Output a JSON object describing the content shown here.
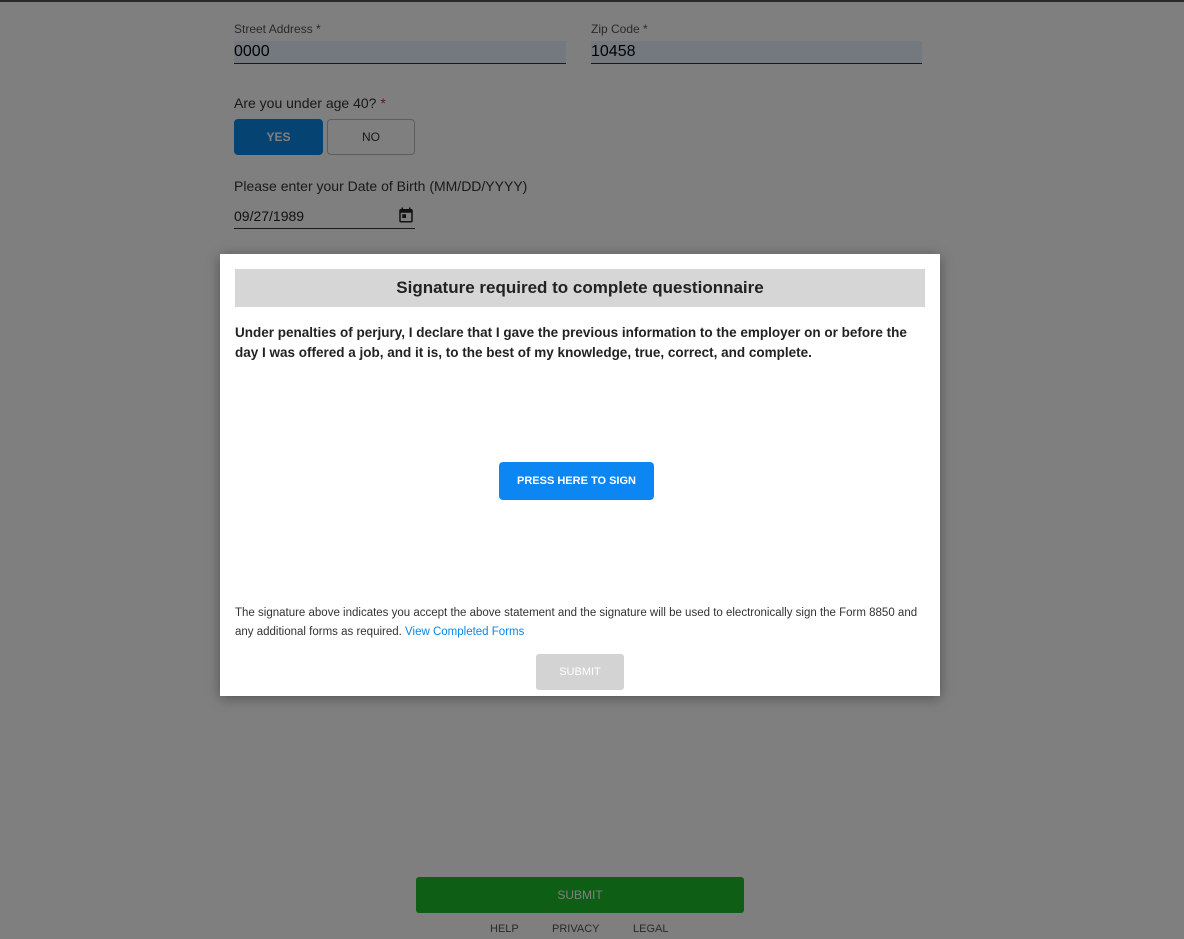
{
  "form": {
    "street_label": "Street Address *",
    "street_value": "0000",
    "zip_label": "Zip Code *",
    "zip_value": "10458",
    "age_question": "Are you under age 40?",
    "age_required_mark": "*",
    "yes_label": "YES",
    "no_label": "NO",
    "dob_question": "Please enter your Date of Birth (MM/DD/YYYY)",
    "dob_value": "09/27/1989"
  },
  "modal": {
    "title": "Signature required to complete questionnaire",
    "statement": "Under penalties of perjury, I declare that I gave the previous information to the employer on or before the day I was offered a job, and it is, to the best of my knowledge, true, correct, and complete.",
    "sign_button": "PRESS HERE TO SIGN",
    "note": "The signature above indicates you accept the above statement and the signature will be used to electronically sign the Form 8850 and any additional forms as required.",
    "view_link": "View Completed Forms",
    "submit_label": "SUBMIT"
  },
  "footer": {
    "submit_label": "SUBMIT",
    "links": [
      "HELP",
      "PRIVACY",
      "LEGAL"
    ]
  },
  "colors": {
    "primary_blue": "#0b86e6",
    "submit_green": "#1cbd2d",
    "required_red": "#d32f2f"
  },
  "icons": {
    "date": "calendar-icon"
  }
}
